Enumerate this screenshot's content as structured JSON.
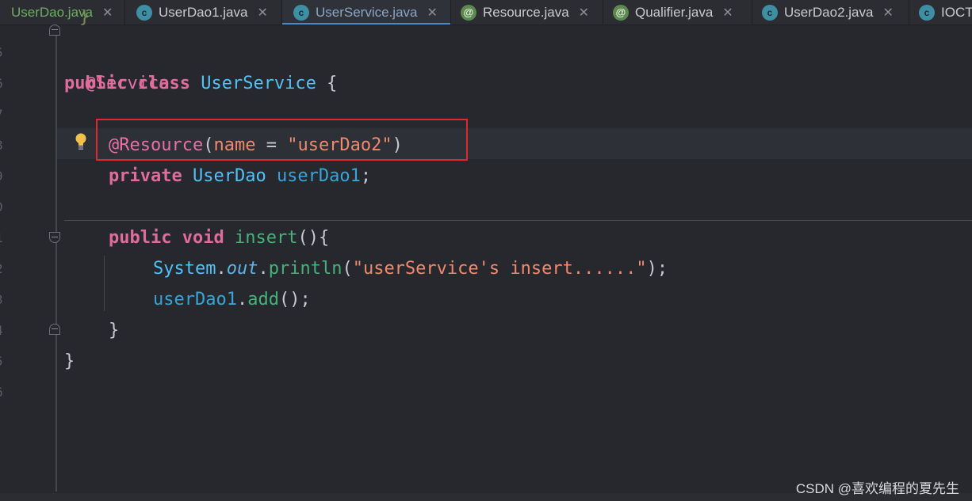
{
  "tabs": [
    {
      "label": "UserDao.java",
      "icon": "interface-icon",
      "kind": "interface"
    },
    {
      "label": "UserDao1.java",
      "icon": "class-icon",
      "kind": "class"
    },
    {
      "label": "UserService.java",
      "icon": "class-icon",
      "kind": "class",
      "active": true
    },
    {
      "label": "Resource.java",
      "icon": "annotation-icon",
      "kind": "annotation"
    },
    {
      "label": "Qualifier.java",
      "icon": "annotation-icon",
      "kind": "annotation"
    },
    {
      "label": "UserDao2.java",
      "icon": "class-icon",
      "kind": "class"
    },
    {
      "label": "IOCT",
      "icon": "class-icon",
      "kind": "class"
    }
  ],
  "gutter": {
    "line_numbers": [
      "5",
      "6",
      "7",
      "8",
      "9",
      "0",
      "1",
      "2",
      "3",
      "4",
      "5",
      "6"
    ]
  },
  "code": {
    "top_fragment": "}",
    "line_service": "@Service",
    "line_class": [
      "public",
      "class",
      "UserService",
      "{"
    ],
    "line_resource": {
      "annotation": "@Resource",
      "param": "name",
      "eq": "=",
      "value": "\"userDao2\"",
      "close": ")"
    },
    "line_field": [
      "private",
      "UserDao",
      "userDao1",
      ";"
    ],
    "line_method": [
      "public",
      "void",
      "insert",
      "(){"
    ],
    "line_println": [
      "System",
      ".",
      "out",
      ".",
      "println",
      "(",
      "\"userService's insert......\"",
      ");"
    ],
    "line_call": [
      "userDao1",
      ".",
      "add",
      "();"
    ],
    "close_method": "}",
    "close_class": "}"
  },
  "watermark": "CSDN @喜欢编程的夏先生",
  "colors": {
    "background": "#26282e",
    "highlight_box": "#e0282d",
    "active_tab_underline": "#4a88c7"
  }
}
